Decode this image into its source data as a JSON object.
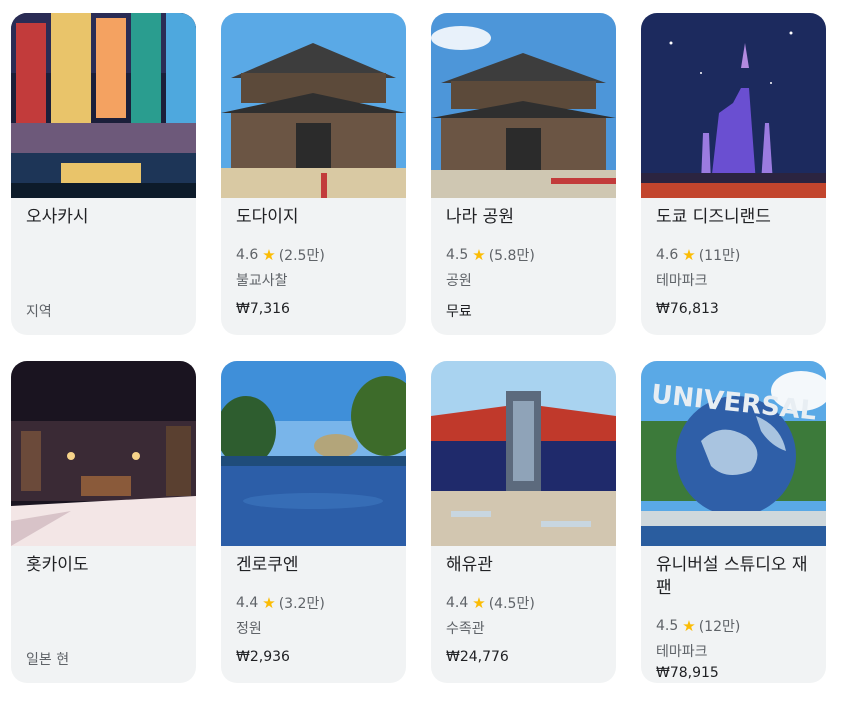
{
  "cards": [
    {
      "title": "오사카시",
      "subtitle": "지역"
    },
    {
      "title": "도다이지",
      "rating": "4.6",
      "reviews": "(2.5만)",
      "category": "불교사찰",
      "price": "₩7,316"
    },
    {
      "title": "나라 공원",
      "rating": "4.5",
      "reviews": "(5.8만)",
      "category": "공원",
      "price": "무료"
    },
    {
      "title": "도쿄 디즈니랜드",
      "rating": "4.6",
      "reviews": "(11만)",
      "category": "테마파크",
      "price": "₩76,813"
    },
    {
      "title": "홋카이도",
      "subtitle": "일본 현"
    },
    {
      "title": "겐로쿠엔",
      "rating": "4.4",
      "reviews": "(3.2만)",
      "category": "정원",
      "price": "₩2,936"
    },
    {
      "title": "해유관",
      "rating": "4.4",
      "reviews": "(4.5만)",
      "category": "수족관",
      "price": "₩24,776"
    },
    {
      "title": "유니버설 스튜디오 재팬",
      "rating": "4.5",
      "reviews": "(12만)",
      "category": "테마파크",
      "price": "₩78,915"
    }
  ],
  "star_glyph": "★",
  "colors": {
    "card_bg": "#f1f3f4",
    "star": "#fbbc04",
    "muted_text": "#5f6368"
  },
  "globe_text": "UNIVERSAL"
}
